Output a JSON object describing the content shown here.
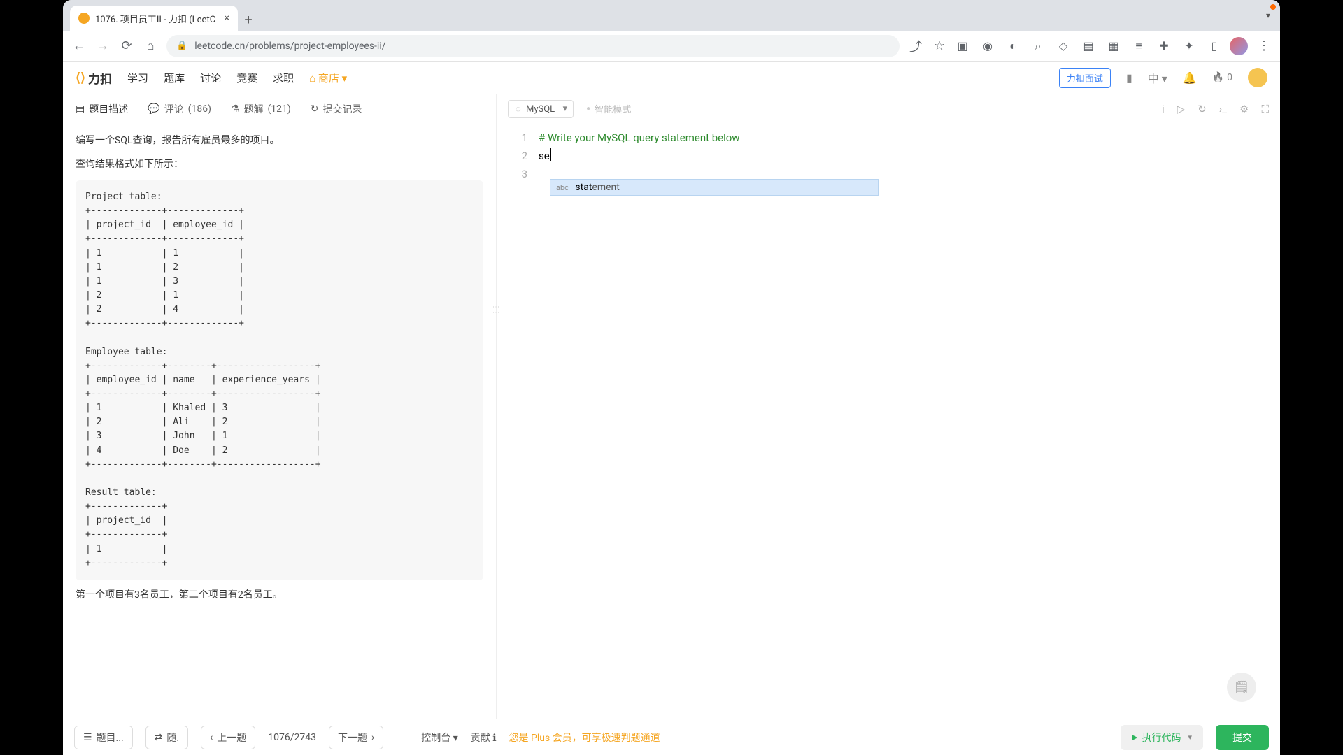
{
  "browser": {
    "tab_title": "1076. 项目员工II - 力扣 (LeetC",
    "url": "leetcode.cn/problems/project-employees-ii/"
  },
  "header": {
    "logo": "力扣",
    "nav": {
      "learn": "学习",
      "problems": "题库",
      "discuss": "讨论",
      "contest": "竞赛",
      "jobs": "求职",
      "shop": "商店"
    },
    "interview_btn": "力扣面试",
    "lang_switch": "中",
    "fire_count": "0"
  },
  "left_tabs": {
    "desc": "题目描述",
    "comments_label": "评论",
    "comments_count": "(186)",
    "solutions_label": "题解",
    "solutions_count": "(121)",
    "submissions": "提交记录"
  },
  "description": {
    "intro": "编写一个SQL查询，报告所有雇员最多的项目。",
    "format_hint": "查询结果格式如下所示：",
    "codebox": "Project table:\n+-------------+-------------+\n| project_id  | employee_id |\n+-------------+-------------+\n| 1           | 1           |\n| 1           | 2           |\n| 1           | 3           |\n| 2           | 1           |\n| 2           | 4           |\n+-------------+-------------+\n\nEmployee table:\n+-------------+--------+------------------+\n| employee_id | name   | experience_years |\n+-------------+--------+------------------+\n| 1           | Khaled | 3                |\n| 2           | Ali    | 2                |\n| 3           | John   | 1                |\n| 4           | Doe    | 2                |\n+-------------+--------+------------------+\n\nResult table:\n+-------------+\n| project_id  |\n+-------------+\n| 1           |\n+-------------+",
    "footnote": "第一个项目有3名员工，第二个项目有2名员工。"
  },
  "editor": {
    "language": "MySQL",
    "smart_mode": "智能模式",
    "lines": {
      "l1": "# Write your MySQL query statement below",
      "l2": "",
      "l3": "se"
    },
    "suggestion_label": "abc",
    "suggestion_prefix": "stat",
    "suggestion_rest": "ement"
  },
  "bottom": {
    "problem_list": "题目...",
    "random": "随.",
    "prev": "上一题",
    "pager": "1076/2743",
    "next": "下一题",
    "console": "控制台",
    "contribute": "贡献",
    "plus_msg": "您是 Plus 会员，可享极速判题通道",
    "run": "执行代码",
    "submit": "提交"
  },
  "chart_data": {
    "type": "table",
    "tables": [
      {
        "name": "Project",
        "columns": [
          "project_id",
          "employee_id"
        ],
        "rows": [
          [
            1,
            1
          ],
          [
            1,
            2
          ],
          [
            1,
            3
          ],
          [
            2,
            1
          ],
          [
            2,
            4
          ]
        ]
      },
      {
        "name": "Employee",
        "columns": [
          "employee_id",
          "name",
          "experience_years"
        ],
        "rows": [
          [
            1,
            "Khaled",
            3
          ],
          [
            2,
            "Ali",
            2
          ],
          [
            3,
            "John",
            1
          ],
          [
            4,
            "Doe",
            2
          ]
        ]
      },
      {
        "name": "Result",
        "columns": [
          "project_id"
        ],
        "rows": [
          [
            1
          ]
        ]
      }
    ]
  }
}
